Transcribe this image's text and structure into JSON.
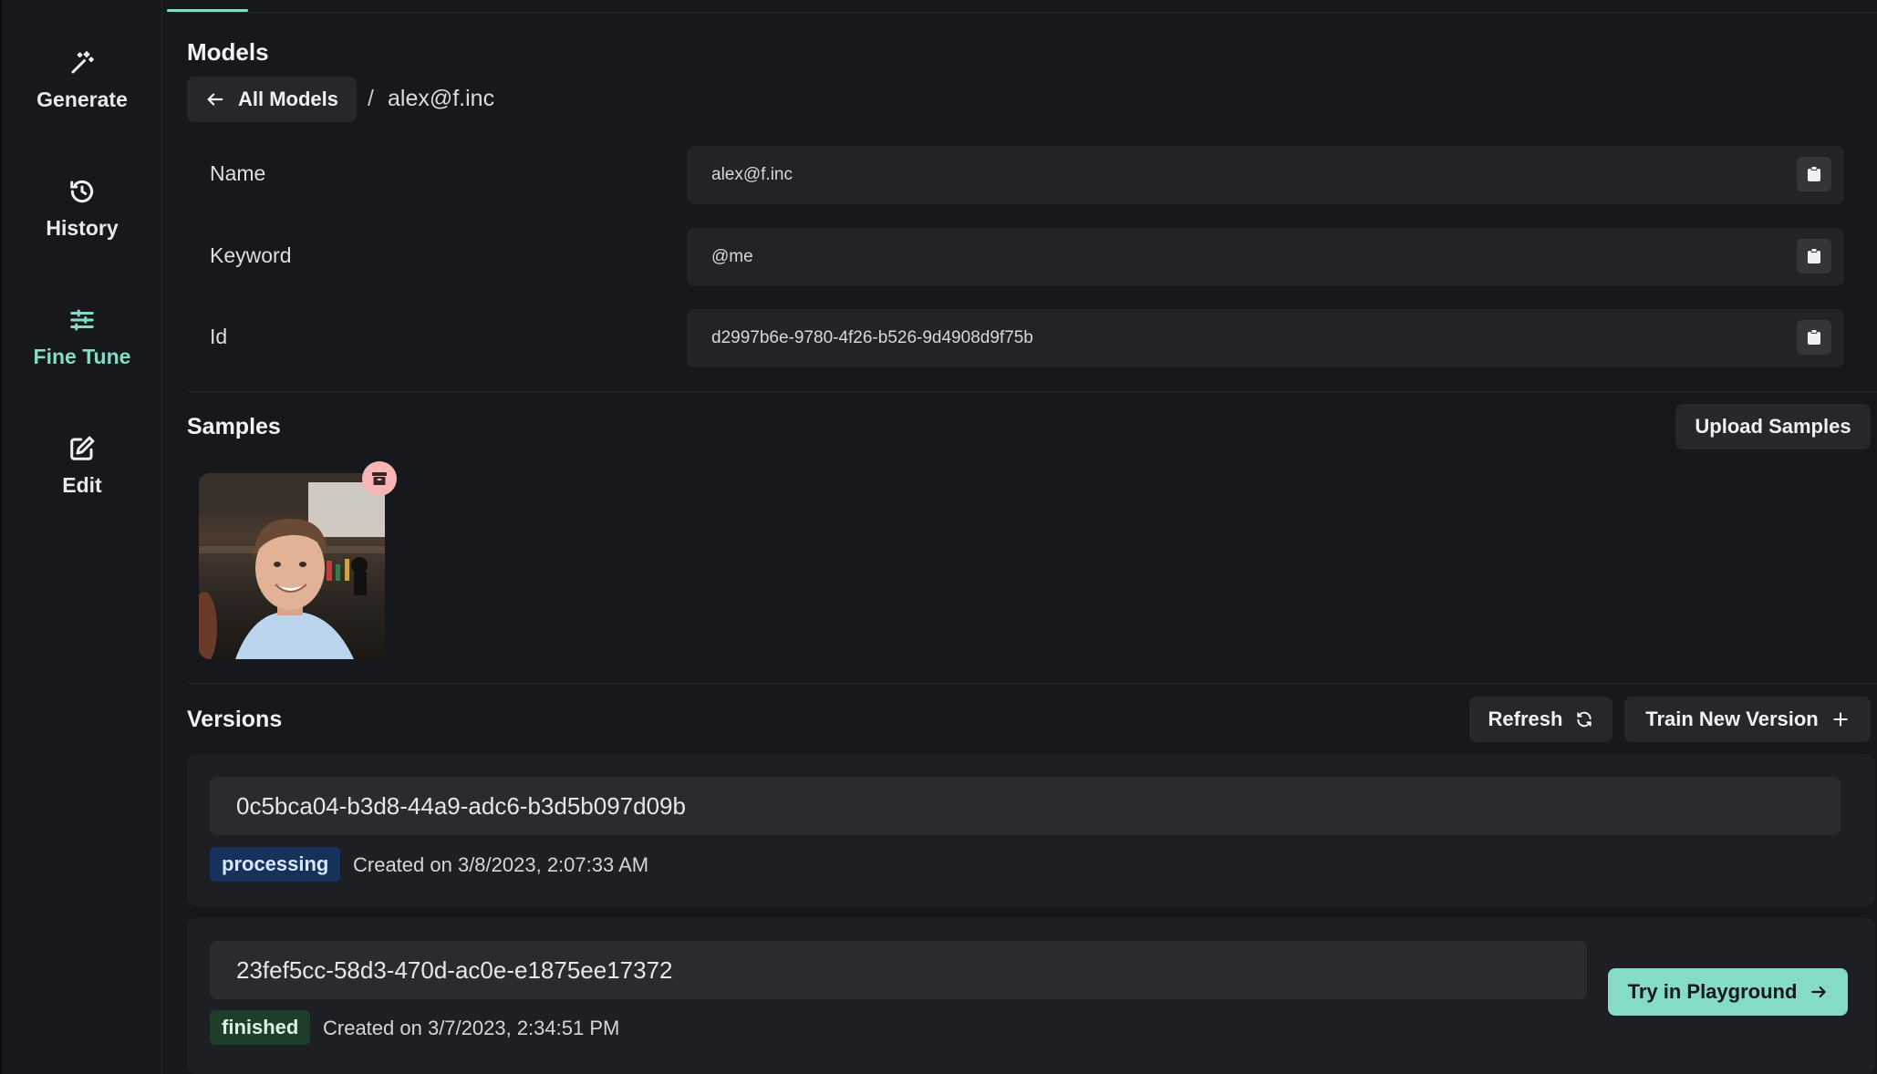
{
  "nav": {
    "items": [
      {
        "label": "Generate",
        "icon": "magic-wand-icon"
      },
      {
        "label": "History",
        "icon": "history-icon"
      },
      {
        "label": "Fine Tune",
        "icon": "sliders-icon",
        "active": true
      },
      {
        "label": "Edit",
        "icon": "edit-icon"
      }
    ]
  },
  "header": {
    "title": "Models",
    "back_label": "All Models",
    "separator": "/",
    "current": "alex@f.inc"
  },
  "fields": [
    {
      "label": "Name",
      "value": "alex@f.inc"
    },
    {
      "label": "Keyword",
      "value": "@me"
    },
    {
      "label": "Id",
      "value": "d2997b6e-9780-4f26-b526-9d4908d9f75b"
    }
  ],
  "samples": {
    "title": "Samples",
    "upload_label": "Upload Samples"
  },
  "versions": {
    "title": "Versions",
    "refresh_label": "Refresh",
    "train_label": "Train New Version",
    "items": [
      {
        "id": "0c5bca04-b3d8-44a9-adc6-b3d5b097d09b",
        "status": "processing",
        "created": "Created on 3/8/2023, 2:07:33 AM"
      },
      {
        "id": "23fef5cc-58d3-470d-ac0e-e1875ee17372",
        "status": "finished",
        "created": "Created on 3/7/2023, 2:34:51 PM",
        "action_label": "Try in Playground"
      }
    ]
  },
  "colors": {
    "accent": "#84dcc6",
    "background": "#17181c",
    "processing": "#17325a",
    "finished": "#1f3d2b"
  }
}
